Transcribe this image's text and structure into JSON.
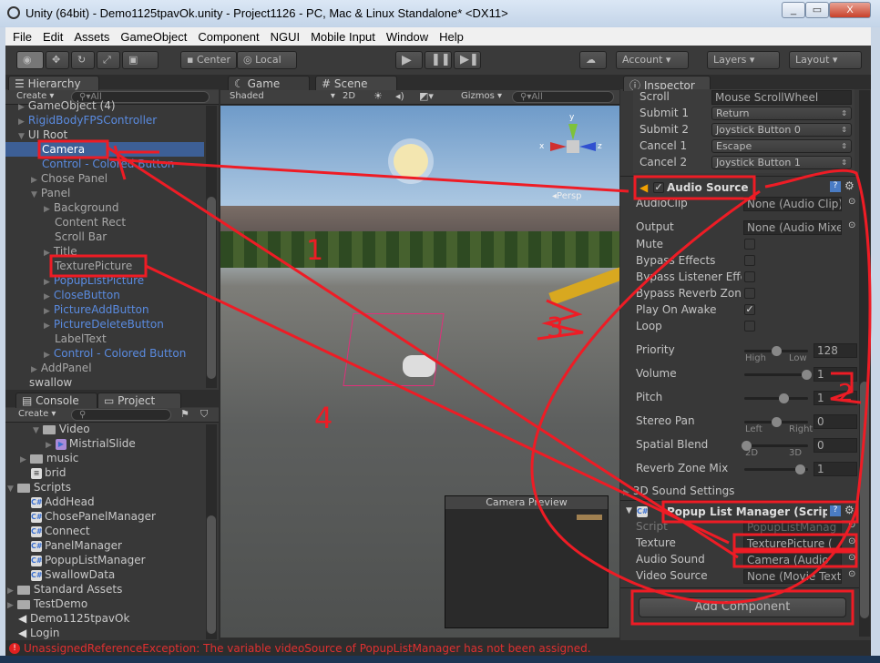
{
  "window": {
    "title": "Unity (64bit) - Demo1125tpavOk.unity - Project1126 - PC, Mac & Linux Standalone* <DX11>",
    "minimize": "_",
    "restore": "▭",
    "close": "X"
  },
  "menu": [
    "File",
    "Edit",
    "Assets",
    "GameObject",
    "Component",
    "NGUI",
    "Mobile Input",
    "Window",
    "Help"
  ],
  "toolbar": {
    "center": "Center",
    "local": "Local",
    "account": "Account",
    "layers": "Layers",
    "layout": "Layout"
  },
  "hierarchy": {
    "tab": "Hierarchy",
    "create": "Create",
    "search": "All",
    "items": [
      {
        "label": "GameObject (4)",
        "indent": 1,
        "arrow": "▶",
        "style": "normal"
      },
      {
        "label": "RigidBodyFPSController",
        "indent": 1,
        "arrow": "▶",
        "style": "blue"
      },
      {
        "label": "UI Root",
        "indent": 1,
        "arrow": "▼",
        "style": "normal"
      },
      {
        "label": "Camera",
        "indent": 2,
        "arrow": "",
        "style": "selected"
      },
      {
        "label": "Control - Colored Button",
        "indent": 2,
        "arrow": "",
        "style": "blue"
      },
      {
        "label": "Chose Panel",
        "indent": 2,
        "arrow": "▶",
        "style": "dim"
      },
      {
        "label": "Panel",
        "indent": 2,
        "arrow": "▼",
        "style": "dim"
      },
      {
        "label": "Background",
        "indent": 3,
        "arrow": "▶",
        "style": "dim"
      },
      {
        "label": "Content Rect",
        "indent": 3,
        "arrow": "",
        "style": "dim"
      },
      {
        "label": "Scroll Bar",
        "indent": 3,
        "arrow": "",
        "style": "dim"
      },
      {
        "label": "Title",
        "indent": 3,
        "arrow": "▶",
        "style": "dim"
      },
      {
        "label": "TexturePicture",
        "indent": 3,
        "arrow": "",
        "style": "dim"
      },
      {
        "label": "PopupListPicture",
        "indent": 3,
        "arrow": "▶",
        "style": "blue"
      },
      {
        "label": "CloseButton",
        "indent": 3,
        "arrow": "▶",
        "style": "blue"
      },
      {
        "label": "PictureAddButton",
        "indent": 3,
        "arrow": "▶",
        "style": "blue"
      },
      {
        "label": "PictureDeleteButton",
        "indent": 3,
        "arrow": "▶",
        "style": "blue"
      },
      {
        "label": "LabelText",
        "indent": 3,
        "arrow": "",
        "style": "dim"
      },
      {
        "label": "Control - Colored Button",
        "indent": 3,
        "arrow": "▶",
        "style": "blue"
      },
      {
        "label": "AddPanel",
        "indent": 2,
        "arrow": "▶",
        "style": "dim"
      },
      {
        "label": "swallow",
        "indent": 1,
        "arrow": "",
        "style": "normal"
      }
    ]
  },
  "project": {
    "console_tab": "Console",
    "project_tab": "Project",
    "create": "Create",
    "items": [
      {
        "label": "Video",
        "indent": 3,
        "arrow": "▼",
        "icon": "folder"
      },
      {
        "label": "MistrialSlide",
        "indent": 4,
        "arrow": "▶",
        "icon": "movie"
      },
      {
        "label": "music",
        "indent": 2,
        "arrow": "▶",
        "icon": "folder"
      },
      {
        "label": "brid",
        "indent": 2,
        "arrow": "",
        "icon": "file"
      },
      {
        "label": "Scripts",
        "indent": 1,
        "arrow": "▼",
        "icon": "folder"
      },
      {
        "label": "AddHead",
        "indent": 2,
        "arrow": "",
        "icon": "cs"
      },
      {
        "label": "ChosePanelManager",
        "indent": 2,
        "arrow": "",
        "icon": "cs"
      },
      {
        "label": "Connect",
        "indent": 2,
        "arrow": "",
        "icon": "cs"
      },
      {
        "label": "PanelManager",
        "indent": 2,
        "arrow": "",
        "icon": "cs"
      },
      {
        "label": "PopupListManager",
        "indent": 2,
        "arrow": "",
        "icon": "cs"
      },
      {
        "label": "SwallowData",
        "indent": 2,
        "arrow": "",
        "icon": "cs"
      },
      {
        "label": "Standard Assets",
        "indent": 1,
        "arrow": "▶",
        "icon": "folder"
      },
      {
        "label": "TestDemo",
        "indent": 1,
        "arrow": "▶",
        "icon": "folder"
      },
      {
        "label": "Demo1125tpavOk",
        "indent": 1,
        "arrow": "",
        "icon": "unity"
      },
      {
        "label": "Login",
        "indent": 1,
        "arrow": "",
        "icon": "unity"
      }
    ]
  },
  "scene": {
    "game_tab": "Game",
    "scene_tab": "Scene",
    "shaded": "Shaded",
    "mode_2d": "2D",
    "gizmos": "Gizmos",
    "search": "All",
    "persp": "Persp",
    "camera_preview": "Camera Preview",
    "axes": {
      "x": "x",
      "y": "y",
      "z": "z"
    }
  },
  "inspector": {
    "tab": "Inspector",
    "input_rows": [
      {
        "label": "Scroll",
        "value": "Mouse ScrollWheel",
        "type": "field"
      },
      {
        "label": "Submit 1",
        "value": "Return",
        "type": "drop"
      },
      {
        "label": "Submit 2",
        "value": "Joystick Button 0",
        "type": "drop"
      },
      {
        "label": "Cancel 1",
        "value": "Escape",
        "type": "drop"
      },
      {
        "label": "Cancel 2",
        "value": "Joystick Button 1",
        "type": "drop"
      }
    ],
    "audio_source": {
      "title": "Audio Source",
      "enabled": true,
      "audio_clip": {
        "label": "AudioClip",
        "value": "None (Audio Clip)"
      },
      "output": {
        "label": "Output",
        "value": "None (Audio Mixer"
      },
      "checks": [
        {
          "label": "Mute",
          "checked": false
        },
        {
          "label": "Bypass Effects",
          "checked": false
        },
        {
          "label": "Bypass Listener Effe",
          "checked": false
        },
        {
          "label": "Bypass Reverb Zone",
          "checked": false
        },
        {
          "label": "Play On Awake",
          "checked": true
        },
        {
          "label": "Loop",
          "checked": false
        }
      ],
      "sliders": [
        {
          "label": "Priority",
          "value": "128",
          "fraction": 0.5,
          "left": "High",
          "right": "Low"
        },
        {
          "label": "Volume",
          "value": "1",
          "fraction": 1.0
        },
        {
          "label": "Pitch",
          "value": "1",
          "fraction": 0.62
        },
        {
          "label": "Stereo Pan",
          "value": "0",
          "fraction": 0.5,
          "left": "Left",
          "right": "Right"
        },
        {
          "label": "Spatial Blend",
          "value": "0",
          "fraction": 0.0,
          "left": "2D",
          "right": "3D"
        },
        {
          "label": "Reverb Zone Mix",
          "value": "1",
          "fraction": 0.9
        }
      ],
      "sound_settings": "3D Sound Settings"
    },
    "popup_list_manager": {
      "title": "Popup List Manager (Script)",
      "fields": [
        {
          "label": "Script",
          "value": "PopupListManag",
          "dim": true
        },
        {
          "label": "Texture",
          "value": "TexturePicture ("
        },
        {
          "label": "Audio Sound",
          "value": "Camera (Audio"
        },
        {
          "label": "Video Source",
          "value": "None (Movie Textu"
        }
      ]
    },
    "add_component": "Add Component"
  },
  "status": {
    "message": "UnassignedReferenceException: The variable videoSource of PopupListManager has not been assigned."
  },
  "annotations": {
    "labels": [
      "1",
      "2",
      "3",
      "4"
    ],
    "color": "#ee1c25"
  }
}
